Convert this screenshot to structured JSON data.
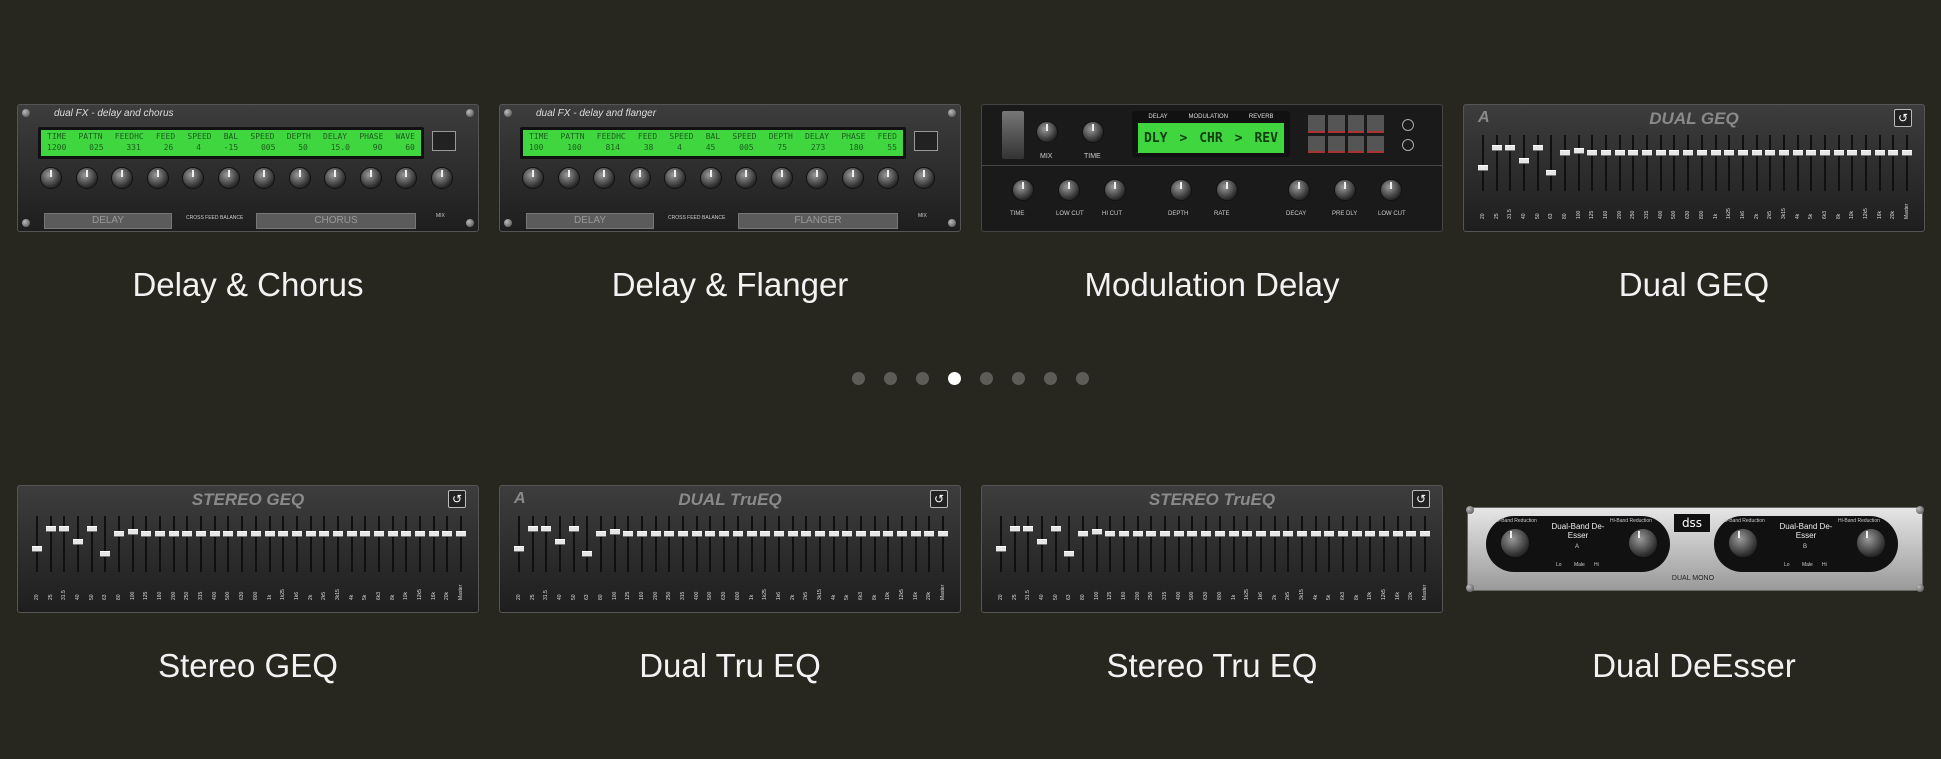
{
  "page_dots": {
    "count": 8,
    "active_index": 3
  },
  "tiles": [
    {
      "caption": "Delay & Chorus",
      "title": "dual FX - delay and chorus",
      "lcd_head": [
        "TIME",
        "PATTN",
        "FEEDHC",
        "FEED",
        "SPEED",
        "BAL",
        "SPEED",
        "DEPTH",
        "DELAY",
        "PHASE",
        "WAVE"
      ],
      "lcd_vals": [
        "1200",
        "025",
        "331",
        "26",
        "4",
        "-15",
        "005",
        "50",
        "15.0",
        "90",
        "60"
      ],
      "left_slot": "DELAY",
      "right_slot": "CHORUS",
      "mid1": "CROSS FEED",
      "mid2": "BALANCE",
      "mix": "MIX"
    },
    {
      "caption": "Delay & Flanger",
      "title": "dual FX - delay and flanger",
      "lcd_head": [
        "TIME",
        "PATTN",
        "FEEDHC",
        "FEED",
        "SPEED",
        "BAL",
        "SPEED",
        "DEPTH",
        "DELAY",
        "PHASE",
        "FEED"
      ],
      "lcd_vals": [
        "100",
        "100",
        "814",
        "38",
        "4",
        "45",
        "005",
        "75",
        "273",
        "180",
        "55"
      ],
      "left_slot": "DELAY",
      "right_slot": "FLANGER",
      "mid1": "CROSS FEED",
      "mid2": "BALANCE",
      "mix": "MIX"
    },
    {
      "caption": "Modulation Delay",
      "lcd_head": [
        "DELAY",
        "MODULATION",
        "REVERB"
      ],
      "lcd_vals": [
        "DLY",
        ">",
        "CHR",
        ">",
        "REV"
      ],
      "top_knobs": [
        "MIX",
        "TIME"
      ],
      "bottom_knobs": [
        "TIME",
        "LOW CUT",
        "HI CUT",
        "DEPTH",
        "RATE",
        "DECAY",
        "PRE DLY",
        "LOW CUT"
      ]
    },
    {
      "caption": "Dual GEQ",
      "title": "DUAL GEQ",
      "badge": "A"
    },
    {
      "caption": "Stereo GEQ",
      "title": "STEREO GEQ",
      "badge": ""
    },
    {
      "caption": "Dual Tru EQ",
      "title": "DUAL TruEQ",
      "badge": "A"
    },
    {
      "caption": "Stereo Tru EQ",
      "title": "STEREO TruEQ",
      "badge": ""
    },
    {
      "caption": "Dual DeEsser",
      "logo": "dss",
      "footer": "DUAL MONO",
      "band_label": "Dual-Band De-Esser",
      "ch_a": "A",
      "ch_b": "B",
      "lo_label": "Lo-Band Reduction",
      "hi_label": "Hi-Band Reduction",
      "switches": [
        "Lo",
        "Male",
        "Hi"
      ]
    }
  ],
  "eq_bands": [
    "20",
    "25",
    "31.5",
    "40",
    "50",
    "63",
    "80",
    "100",
    "125",
    "160",
    "200",
    "250",
    "315",
    "400",
    "500",
    "630",
    "800",
    "1k",
    "1k25",
    "1k6",
    "2k",
    "2k5",
    "3k15",
    "4k",
    "5k",
    "6k3",
    "8k",
    "10k",
    "12k5",
    "16k",
    "20k",
    "Master"
  ],
  "reset_icon": "reset-icon"
}
